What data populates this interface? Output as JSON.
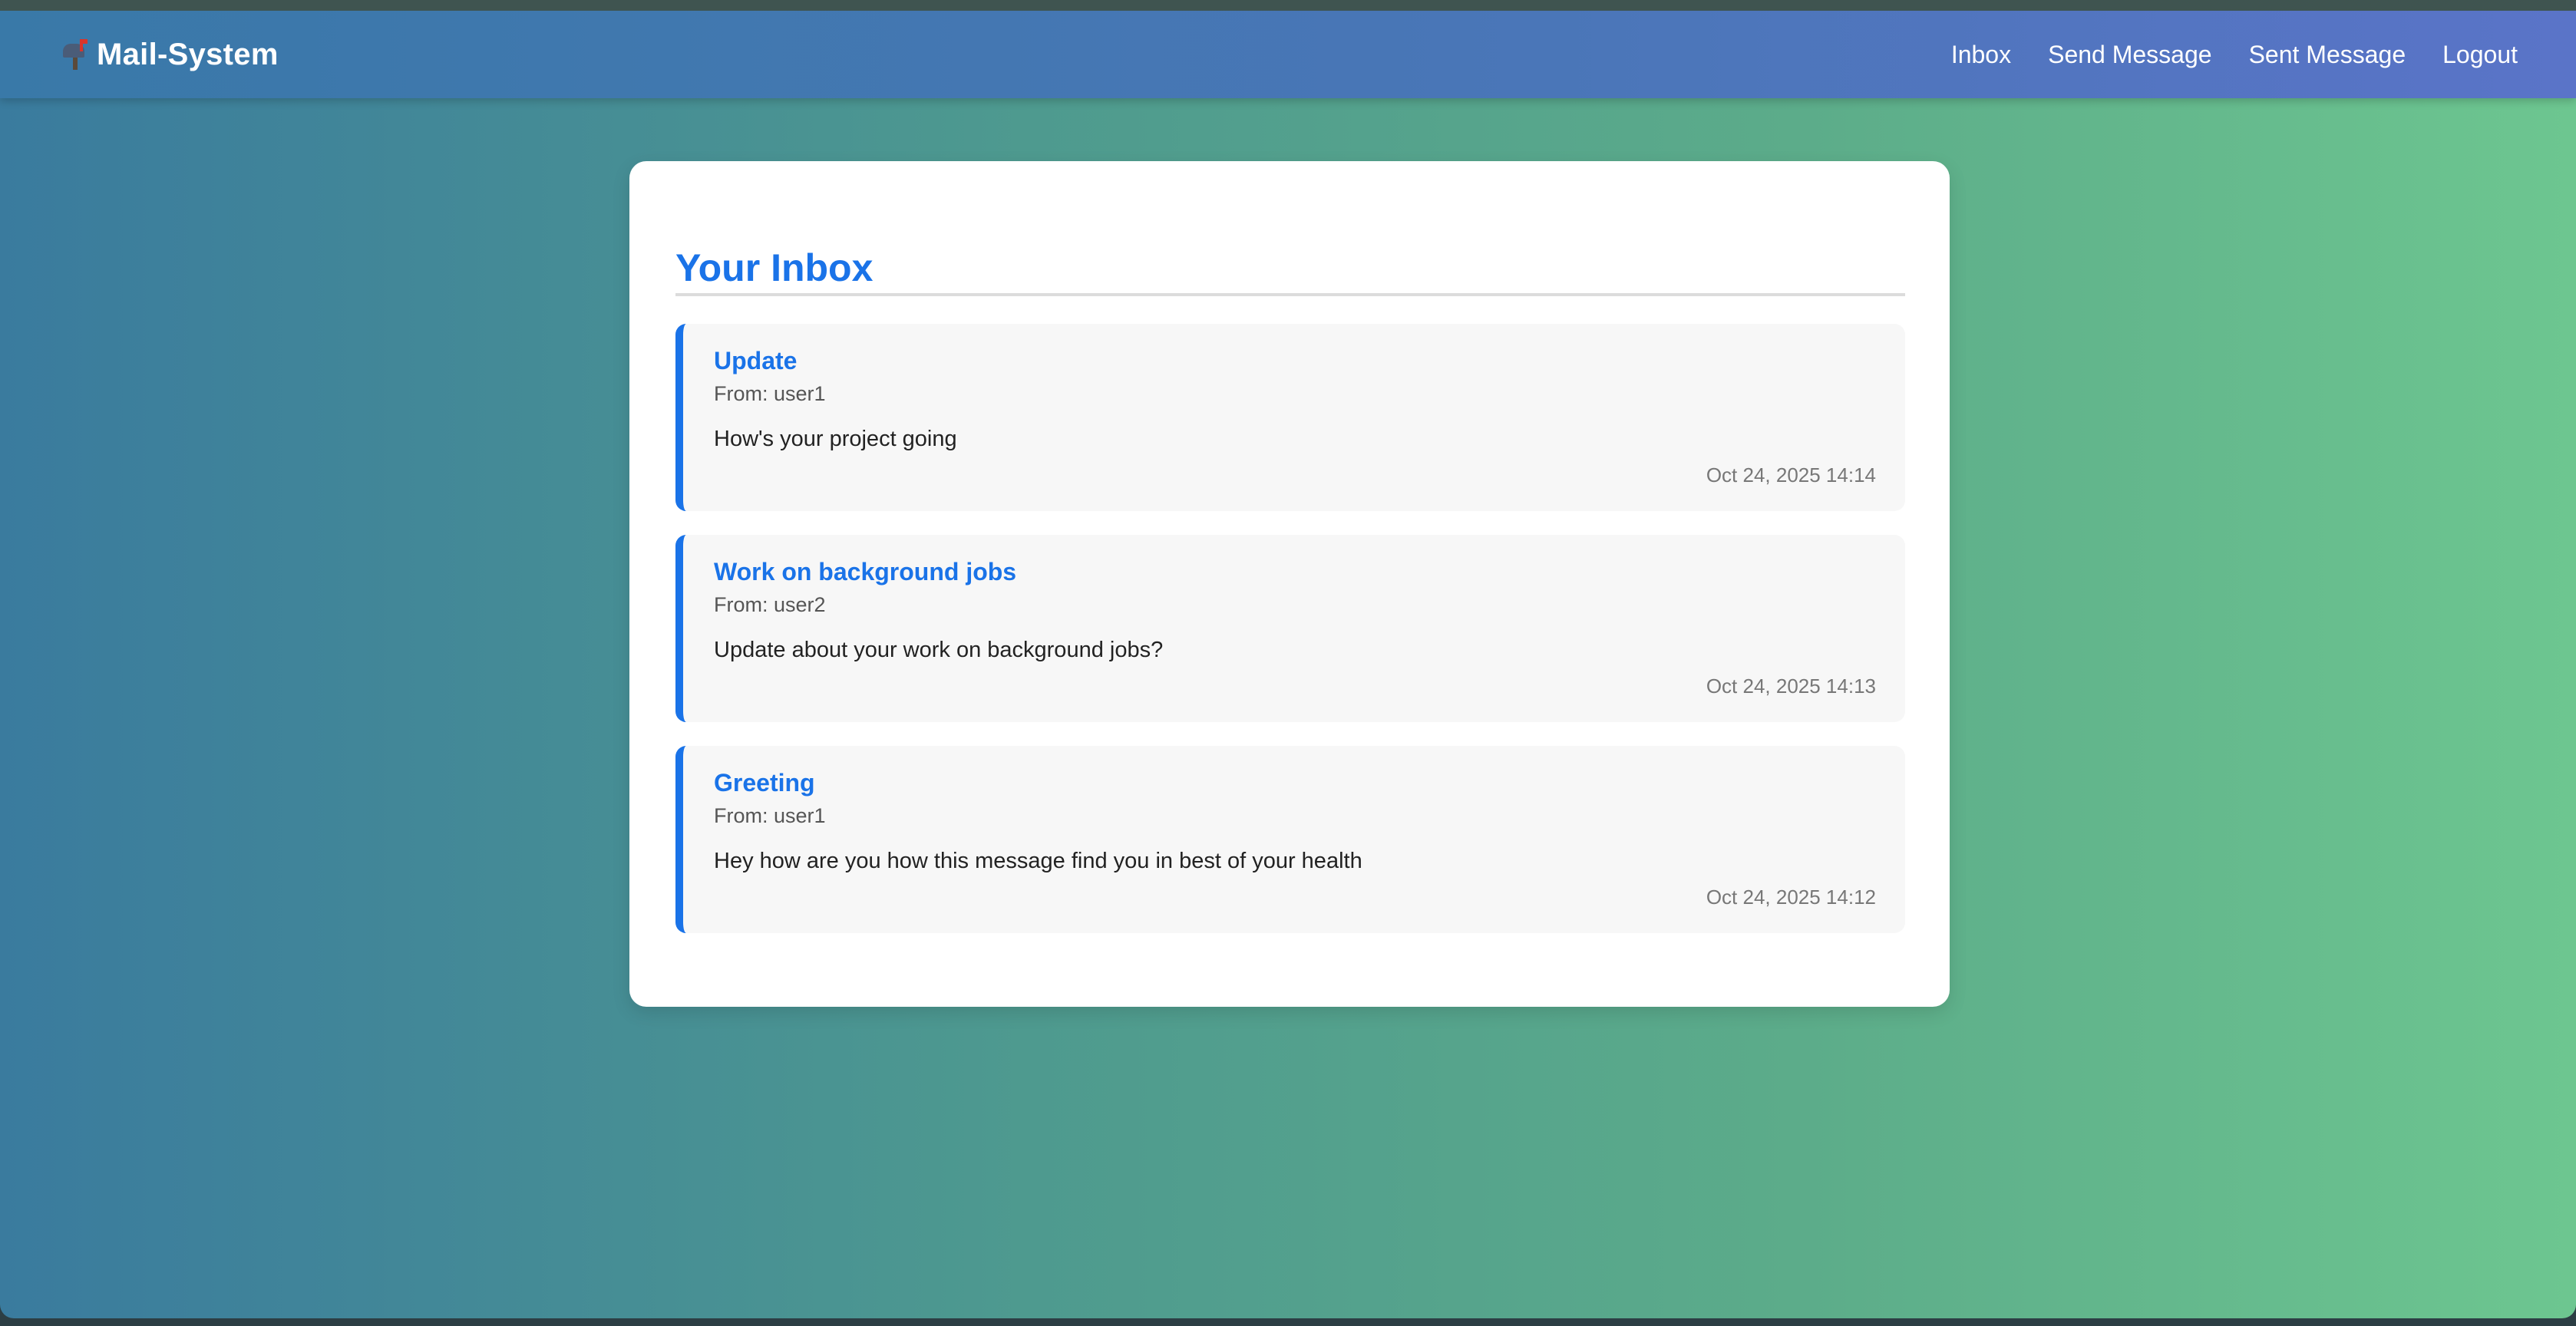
{
  "app": {
    "brand_name": "Mail-System",
    "brand_icon": "mailbox-icon"
  },
  "nav": {
    "inbox": "Inbox",
    "send_message": "Send Message",
    "sent_message": "Sent Message",
    "logout": "Logout"
  },
  "inbox": {
    "title": "Your Inbox",
    "messages": [
      {
        "subject": "Update",
        "from": "From: user1",
        "body": "How's your project going",
        "time": "Oct 24, 2025 14:14"
      },
      {
        "subject": "Work on background jobs",
        "from": "From: user2",
        "body": "Update about your work on background jobs?",
        "time": "Oct 24, 2025 14:13"
      },
      {
        "subject": "Greeting",
        "from": "From: user1",
        "body": "Hey how are you how this message find you in best of your health",
        "time": "Oct 24, 2025 14:12"
      }
    ]
  },
  "colors": {
    "accent": "#1a73e8",
    "navbar_start": "#3979a8",
    "navbar_end": "#5a74c8",
    "background_start": "#3a7b9e",
    "background_end": "#6dc690"
  }
}
